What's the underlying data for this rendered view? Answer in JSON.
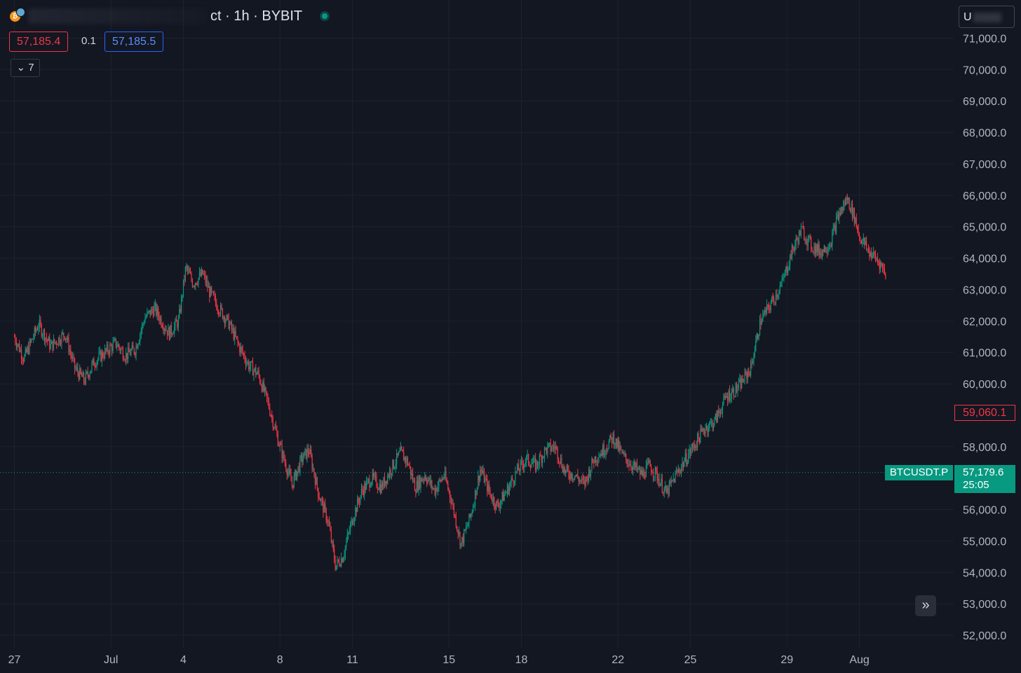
{
  "header": {
    "title": "ct · 1h · BYBIT",
    "sell_price": "57,185.4",
    "spread": "0.1",
    "buy_price": "57,185.5",
    "collapse_label": "7",
    "top_right_button": "U"
  },
  "price_labels": {
    "symbol": "BTCUSDT.P",
    "last_price": "57,179.6",
    "countdown": "25:05",
    "high_marker": "59,060.1"
  },
  "colors": {
    "background": "#131722",
    "up": "#089981",
    "down": "#f23645",
    "grid": "#1e222d",
    "axis_text": "#b2b5be"
  },
  "chart_data": {
    "type": "candlestick",
    "symbol": "BTCUSDT.P",
    "interval": "1h",
    "exchange": "BYBIT",
    "ylim": [
      51500,
      71400
    ],
    "yticks": [
      71000,
      70000,
      69000,
      68000,
      67000,
      66000,
      65000,
      64000,
      63000,
      62000,
      61000,
      60000,
      58000,
      56000,
      55000,
      54000,
      53000,
      52000
    ],
    "ytick_labels": [
      "71,000.0",
      "70,000.0",
      "69,000.0",
      "68,000.0",
      "67,000.0",
      "66,000.0",
      "65,000.0",
      "64,000.0",
      "63,000.0",
      "62,000.0",
      "61,000.0",
      "60,000.0",
      "58,000.0",
      "56,000.0",
      "55,000.0",
      "54,000.0",
      "53,000.0",
      "52,000.0"
    ],
    "xticks": [
      "27",
      "Jul",
      "4",
      "8",
      "11",
      "15",
      "18",
      "22",
      "25",
      "29",
      "Aug"
    ],
    "xtick_days": [
      0,
      4,
      7,
      11,
      14,
      18,
      21,
      25,
      28,
      32,
      35
    ],
    "days_visible": [
      0,
      39.2
    ],
    "price_path": [
      [
        0.0,
        61500
      ],
      [
        0.4,
        60800
      ],
      [
        1.0,
        61900
      ],
      [
        1.5,
        61200
      ],
      [
        2.1,
        61600
      ],
      [
        2.5,
        60500
      ],
      [
        2.9,
        60100
      ],
      [
        3.3,
        60700
      ],
      [
        3.6,
        60900
      ],
      [
        3.9,
        61100
      ],
      [
        4.2,
        61300
      ],
      [
        4.6,
        60900
      ],
      [
        5.0,
        61100
      ],
      [
        5.4,
        62100
      ],
      [
        5.8,
        62400
      ],
      [
        6.4,
        61600
      ],
      [
        6.8,
        62000
      ],
      [
        7.1,
        63700
      ],
      [
        7.4,
        63200
      ],
      [
        7.8,
        63500
      ],
      [
        8.1,
        62900
      ],
      [
        8.4,
        62500
      ],
      [
        8.9,
        61900
      ],
      [
        9.3,
        61200
      ],
      [
        9.7,
        60600
      ],
      [
        10.1,
        60300
      ],
      [
        10.5,
        59400
      ],
      [
        11.0,
        58000
      ],
      [
        11.5,
        56800
      ],
      [
        11.9,
        57600
      ],
      [
        12.2,
        57900
      ],
      [
        12.6,
        56500
      ],
      [
        13.0,
        55600
      ],
      [
        13.3,
        54200
      ],
      [
        13.6,
        54500
      ],
      [
        14.0,
        55700
      ],
      [
        14.4,
        56600
      ],
      [
        14.8,
        57000
      ],
      [
        15.2,
        56700
      ],
      [
        15.6,
        57300
      ],
      [
        16.0,
        57800
      ],
      [
        16.3,
        57500
      ],
      [
        16.6,
        56700
      ],
      [
        17.0,
        57100
      ],
      [
        17.4,
        56600
      ],
      [
        17.8,
        57100
      ],
      [
        18.1,
        56300
      ],
      [
        18.5,
        54900
      ],
      [
        18.9,
        55800
      ],
      [
        19.3,
        57300
      ],
      [
        19.7,
        56500
      ],
      [
        20.0,
        56100
      ],
      [
        20.4,
        56600
      ],
      [
        20.8,
        57200
      ],
      [
        21.2,
        57600
      ],
      [
        21.6,
        57400
      ],
      [
        22.0,
        57900
      ],
      [
        22.4,
        58000
      ],
      [
        22.8,
        57200
      ],
      [
        23.2,
        57100
      ],
      [
        23.6,
        56800
      ],
      [
        24.0,
        57600
      ],
      [
        24.4,
        57900
      ],
      [
        24.8,
        58300
      ],
      [
        25.2,
        57700
      ],
      [
        25.6,
        57400
      ],
      [
        26.0,
        57100
      ],
      [
        26.3,
        57400
      ],
      [
        26.6,
        57100
      ],
      [
        27.0,
        56500
      ],
      [
        27.4,
        57100
      ],
      [
        27.8,
        57600
      ],
      [
        28.2,
        58100
      ],
      [
        28.6,
        58600
      ],
      [
        29.0,
        58800
      ],
      [
        29.5,
        59600
      ],
      [
        30.0,
        59900
      ],
      [
        30.5,
        60500
      ],
      [
        30.9,
        62000
      ],
      [
        31.3,
        62500
      ],
      [
        31.8,
        63200
      ],
      [
        32.2,
        64200
      ],
      [
        32.6,
        64900
      ],
      [
        33.0,
        64400
      ],
      [
        33.4,
        64200
      ],
      [
        33.8,
        64500
      ],
      [
        34.1,
        65300
      ],
      [
        34.5,
        65900
      ],
      [
        34.8,
        65300
      ],
      [
        35.0,
        64700
      ],
      [
        35.4,
        64200
      ],
      [
        35.8,
        63900
      ],
      [
        36.1,
        63500
      ]
    ]
  }
}
